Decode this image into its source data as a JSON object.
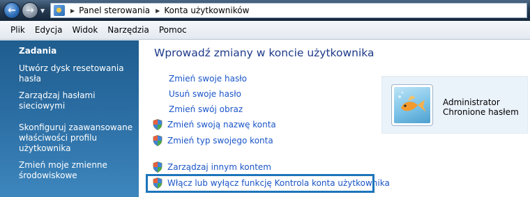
{
  "address_bar": {
    "breadcrumbs": [
      "Panel sterowania",
      "Konta użytkowników"
    ],
    "icon": "control-panel-icon"
  },
  "menu": {
    "items": [
      "Plik",
      "Edycja",
      "Widok",
      "Narzędzia",
      "Pomoc"
    ]
  },
  "sidebar": {
    "heading": "Zadania",
    "links": [
      "Utwórz dysk resetowania hasła",
      "Zarządzaj hasłami sieciowymi",
      "Skonfiguruj zaawansowane właściwości profilu użytkownika",
      "Zmień moje zmienne środowiskowe"
    ]
  },
  "main": {
    "title": "Wprowadź zmiany w koncie użytkownika",
    "links": [
      {
        "label": "Zmień swoje hasło",
        "shield": false
      },
      {
        "label": "Usuń swoje hasło",
        "shield": false
      },
      {
        "label": "Zmień swój obraz",
        "shield": false
      },
      {
        "label": "Zmień swoją nazwę konta",
        "shield": true
      },
      {
        "label": "Zmień typ swojego konta",
        "shield": true
      },
      {
        "label": "Zarządzaj innym kontem",
        "shield": true
      },
      {
        "label": "Włącz lub wyłącz funkcję Kontrola konta użytkownika",
        "shield": true
      }
    ]
  },
  "user": {
    "name": "Administrator",
    "status": "Chronione hasłem",
    "avatar": "goldfish-avatar"
  },
  "colors": {
    "link": "#1a55c8",
    "title": "#1e3a8a",
    "sidebar": "#2c6fa5",
    "highlight_border": "#1c75bb"
  }
}
